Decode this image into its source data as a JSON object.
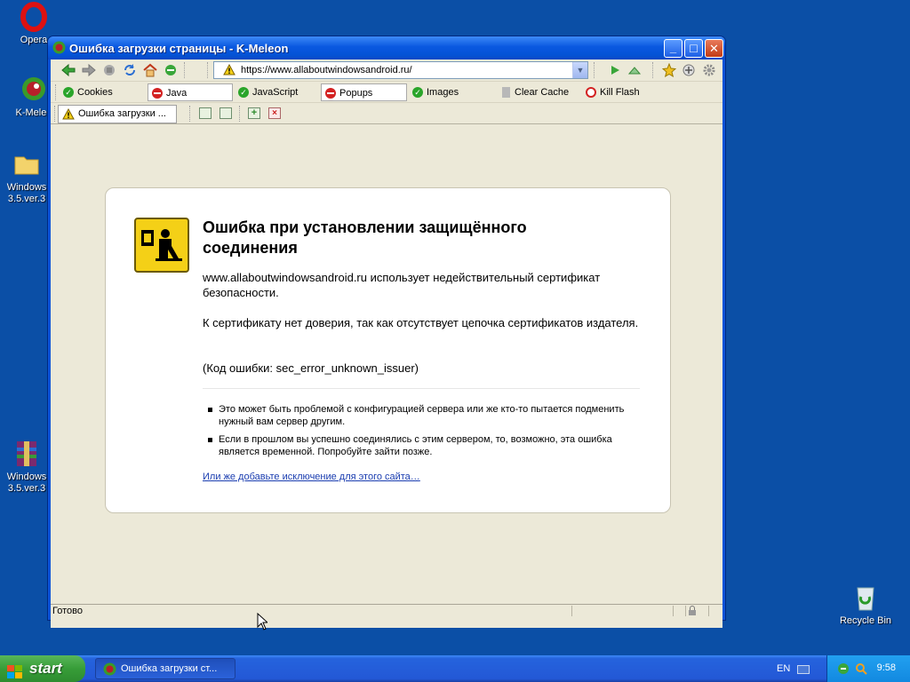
{
  "desktop": {
    "icons": [
      {
        "label": "Opera"
      },
      {
        "label": "K-Meleo"
      },
      {
        "label": "Windows\n3.5.ver.3"
      },
      {
        "label": "Windows\n3.5.ver.3"
      },
      {
        "label": "Recycle Bin"
      }
    ]
  },
  "window": {
    "title": "Ошибка загрузки страницы - K-Meleon",
    "controls": {
      "minimize": "_",
      "maximize": "□",
      "close": "✕"
    }
  },
  "navbar": {
    "url": "https://www.allaboutwindowsandroid.ru/",
    "buttons": [
      "back-icon",
      "forward-icon",
      "stop-icon",
      "reload-icon",
      "home-icon",
      "feed-icon",
      "go-icon",
      "up-icon",
      "bookmark-star-icon",
      "zoom-icon",
      "gear-icon"
    ]
  },
  "bookmarks": [
    {
      "label": "Cookies",
      "state": "ok"
    },
    {
      "label": "Java",
      "state": "blocked"
    },
    {
      "label": "JavaScript",
      "state": "ok"
    },
    {
      "label": "Popups",
      "state": "blocked"
    },
    {
      "label": "Images",
      "state": "ok"
    },
    {
      "label": "Clear Cache",
      "state": "action"
    },
    {
      "label": "Kill Flash",
      "state": "action"
    }
  ],
  "tabbar": {
    "active_tab": "Ошибка загрузки ..."
  },
  "error_page": {
    "title": "Ошибка при установлении защищённого соединения",
    "para1": "www.allaboutwindowsandroid.ru использует недействительный сертификат безопасности.",
    "para2": "К сертификату нет доверия, так как отсутствует цепочка сертификатов издателя.",
    "code": "(Код ошибки: sec_error_unknown_issuer)",
    "bullets": [
      "Это может быть проблемой с конфигурацией сервера или же кто-то пытается подменить нужный вам сервер другим.",
      "Если в прошлом вы успешно соединялись с этим сервером, то, возможно, эта ошибка является временной. Попробуйте зайти позже."
    ],
    "add_exception": "Или же добавьте исключение для этого сайта…"
  },
  "statusbar": {
    "text": "Готово"
  },
  "taskbar": {
    "start": "start",
    "task": "Ошибка загрузки ст...",
    "lang": "EN",
    "clock": "9:58"
  },
  "colors": {
    "desktop": "#0b4fa6",
    "titlebar": "#0453d6",
    "start": "#379d38",
    "link": "#1a3db0",
    "warning_yellow": "#f4d017"
  }
}
